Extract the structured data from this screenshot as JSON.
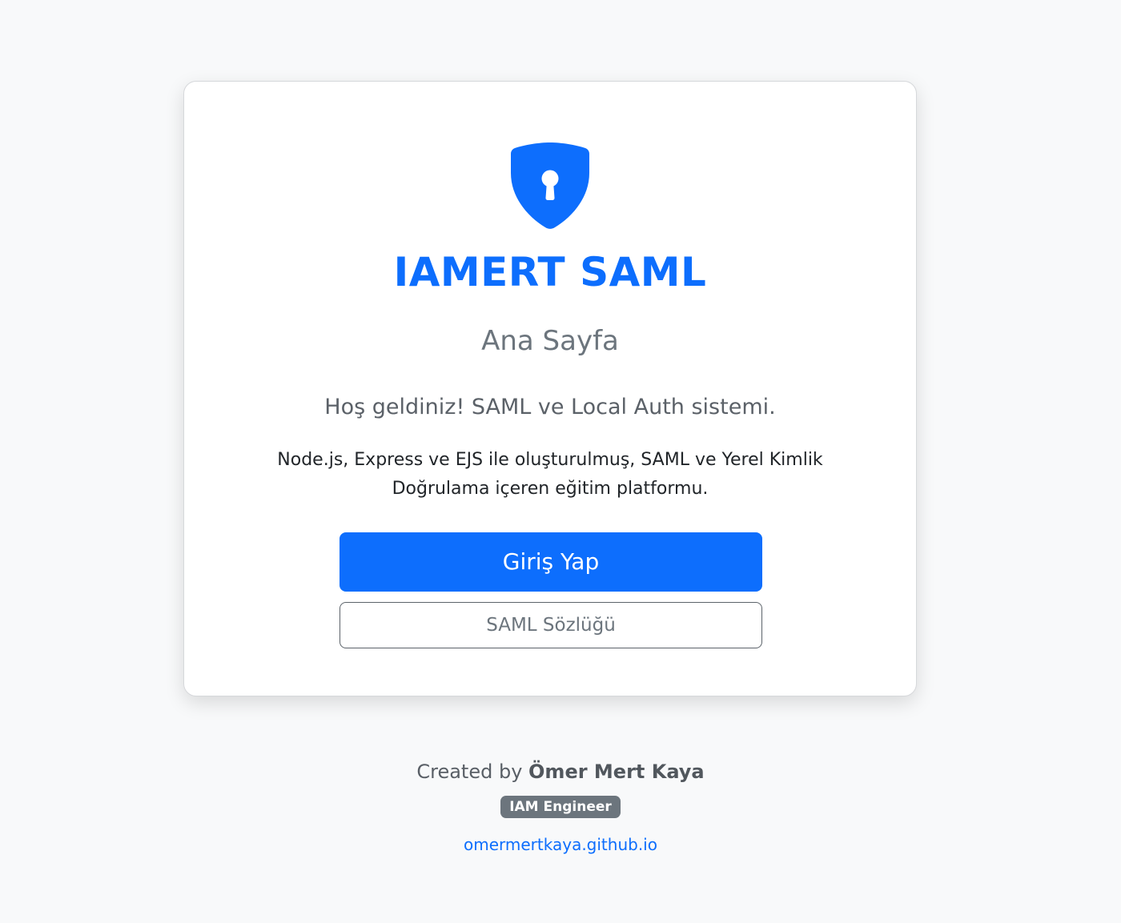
{
  "card": {
    "icon": "shield-lock-icon",
    "brand": "IAMERT SAML",
    "subtitle": "Ana Sayfa",
    "lead": "Hoş geldiniz! SAML ve Local Auth sistemi.",
    "description": "Node.js, Express ve EJS ile oluşturulmuş, SAML ve Yerel Kimlik Doğrulama içeren eğitim platformu.",
    "login_button": "Giriş Yap",
    "glossary_button": "SAML Sözlüğü"
  },
  "footer": {
    "created_prefix": "Created by",
    "author": "Ömer Mert Kaya",
    "badge": "IAM Engineer",
    "link": "omermertkaya.github.io"
  },
  "colors": {
    "primary": "#0d6efd",
    "secondary": "#6c757d",
    "background": "#f8f9fa"
  }
}
